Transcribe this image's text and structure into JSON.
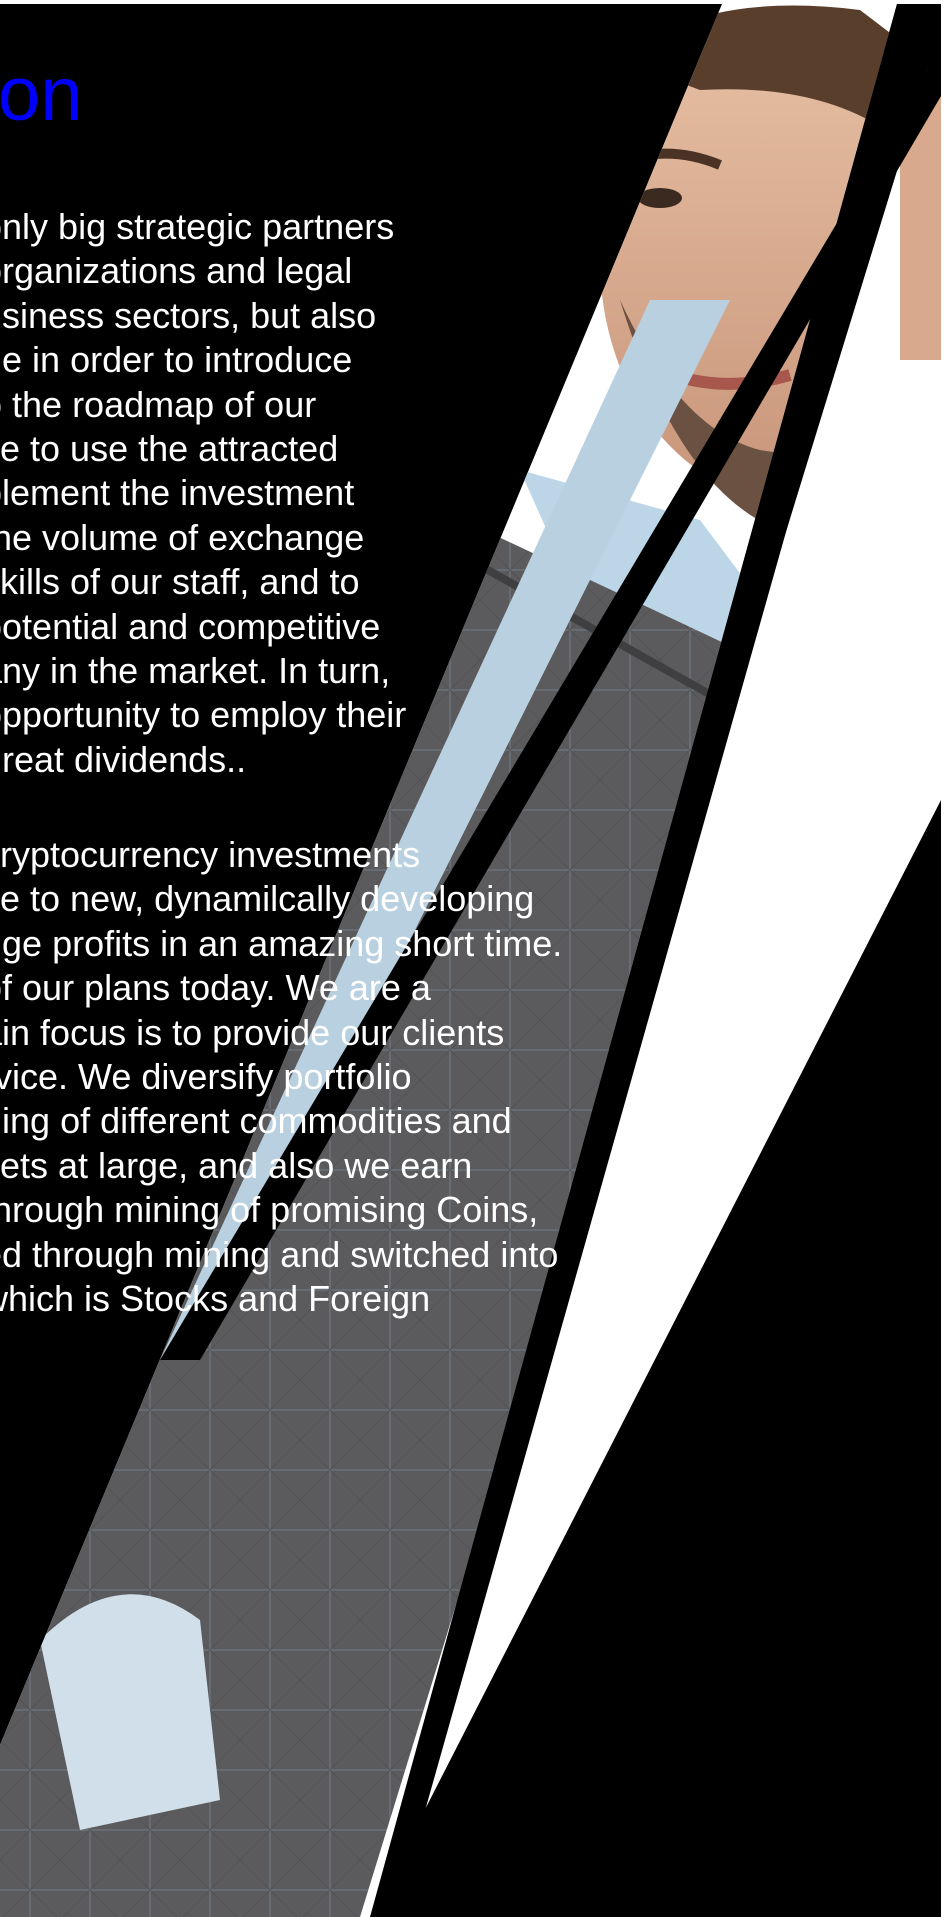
{
  "heading": "on",
  "paragraph_1": [
    "only big strategic partners",
    "organizations and legal",
    "usiness sectors, but also",
    "ne in order to introduce",
    "o the roadmap of our",
    "ke to use the attracted",
    "plement the investment",
    "the volume of exchange",
    "skills of our staff, and to",
    "ootential and competitive",
    "any in the market. In turn,",
    "opportunity to employ their",
    "great dividends.."
  ],
  "paragraph_2": [
    "cryptocurrency investments",
    "ce to new, dynamilcally developing",
    "uge profits in an amazing short time.",
    "of our plans today. We are a",
    "ain focus is to provide our clients",
    "rvice. We diversify portfolio",
    "ding of different commodities and",
    "kets at large, and also we earn",
    "through mining of promising Coins,",
    "ed through mining and switched into",
    "which is Stocks and Foreign"
  ],
  "colors": {
    "heading": "#0000ff",
    "text": "#ffffff",
    "background": "#000000"
  }
}
